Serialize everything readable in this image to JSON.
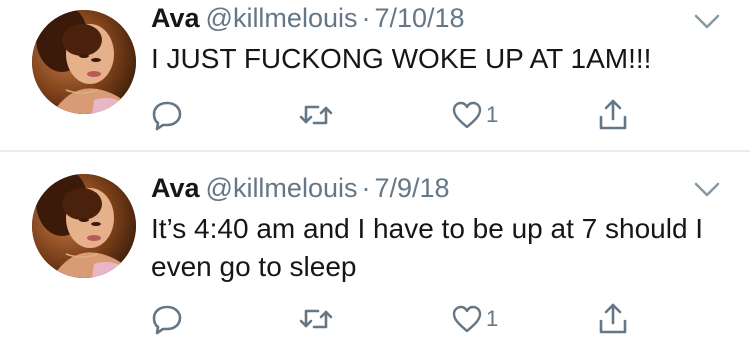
{
  "tweets": [
    {
      "name": "Ava",
      "handle": "@killmelouis",
      "separator": "·",
      "date": "7/10/18",
      "text": "I JUST FUCKONG WOKE UP AT 1AM!!!",
      "like_count": "1"
    },
    {
      "name": "Ava",
      "handle": "@killmelouis",
      "separator": "·",
      "date": "7/9/18",
      "text": "It’s 4:40 am and I have to be up at 7 should I even go to sleep",
      "like_count": "1"
    }
  ],
  "icons": {
    "reply": "reply-icon",
    "retweet": "retweet-icon",
    "like": "heart-icon",
    "share": "share-icon",
    "more": "chevron-down-icon"
  },
  "colors": {
    "text": "#14171a",
    "secondary": "#657786",
    "icon": "#657786",
    "divider": "#e6ecf0"
  }
}
